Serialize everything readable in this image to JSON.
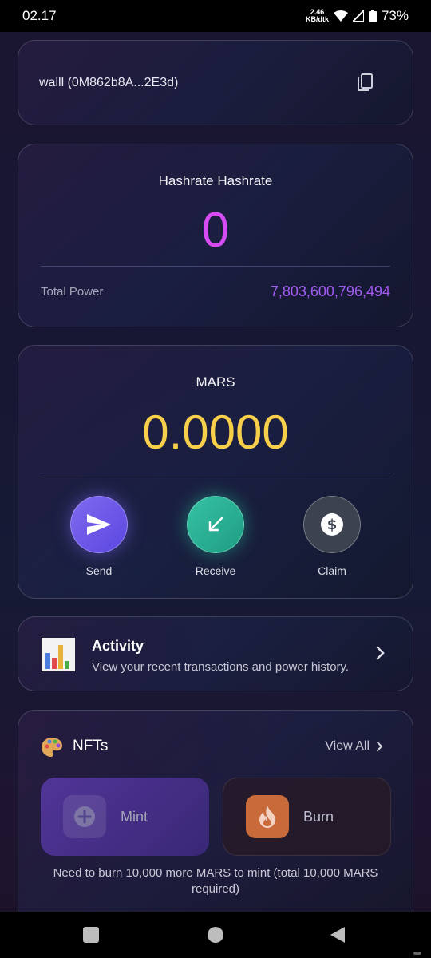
{
  "status_bar": {
    "time": "02.17",
    "net_speed_value": "2.46",
    "net_speed_unit": "KB/dtk",
    "battery": "73%"
  },
  "wallet": {
    "label": "walll (0M862b8A...2E3d)"
  },
  "hashrate": {
    "title": "Hashrate Hashrate",
    "value": "0",
    "total_label": "Total Power",
    "total_value": "7,803,600,796,494"
  },
  "mars": {
    "title": "MARS",
    "balance": "0.0000",
    "actions": {
      "send": "Send",
      "receive": "Receive",
      "claim": "Claim"
    }
  },
  "activity": {
    "title": "Activity",
    "subtitle": "View your recent transactions and power history."
  },
  "nfts": {
    "title": "NFTs",
    "view_all": "View All",
    "mint": "Mint",
    "burn": "Burn",
    "note": "Need to burn 10,000 more MARS to mint (total 10,000 MARS required)"
  },
  "colors": {
    "hashrate_value": "#d64cf2",
    "total_power": "#a35cf0",
    "mars_balance": "#f7cf4a",
    "send": "#6c58ea",
    "receive": "#2bb094",
    "claim": "#3d4250"
  },
  "icons": {
    "copy": "copy-icon",
    "send": "paper-plane-icon",
    "receive": "arrow-down-left-icon",
    "claim": "dollar-coin-icon",
    "activity": "bar-chart-icon",
    "nfts": "palette-icon",
    "mint": "plus-circle-icon",
    "burn": "fire-icon"
  }
}
